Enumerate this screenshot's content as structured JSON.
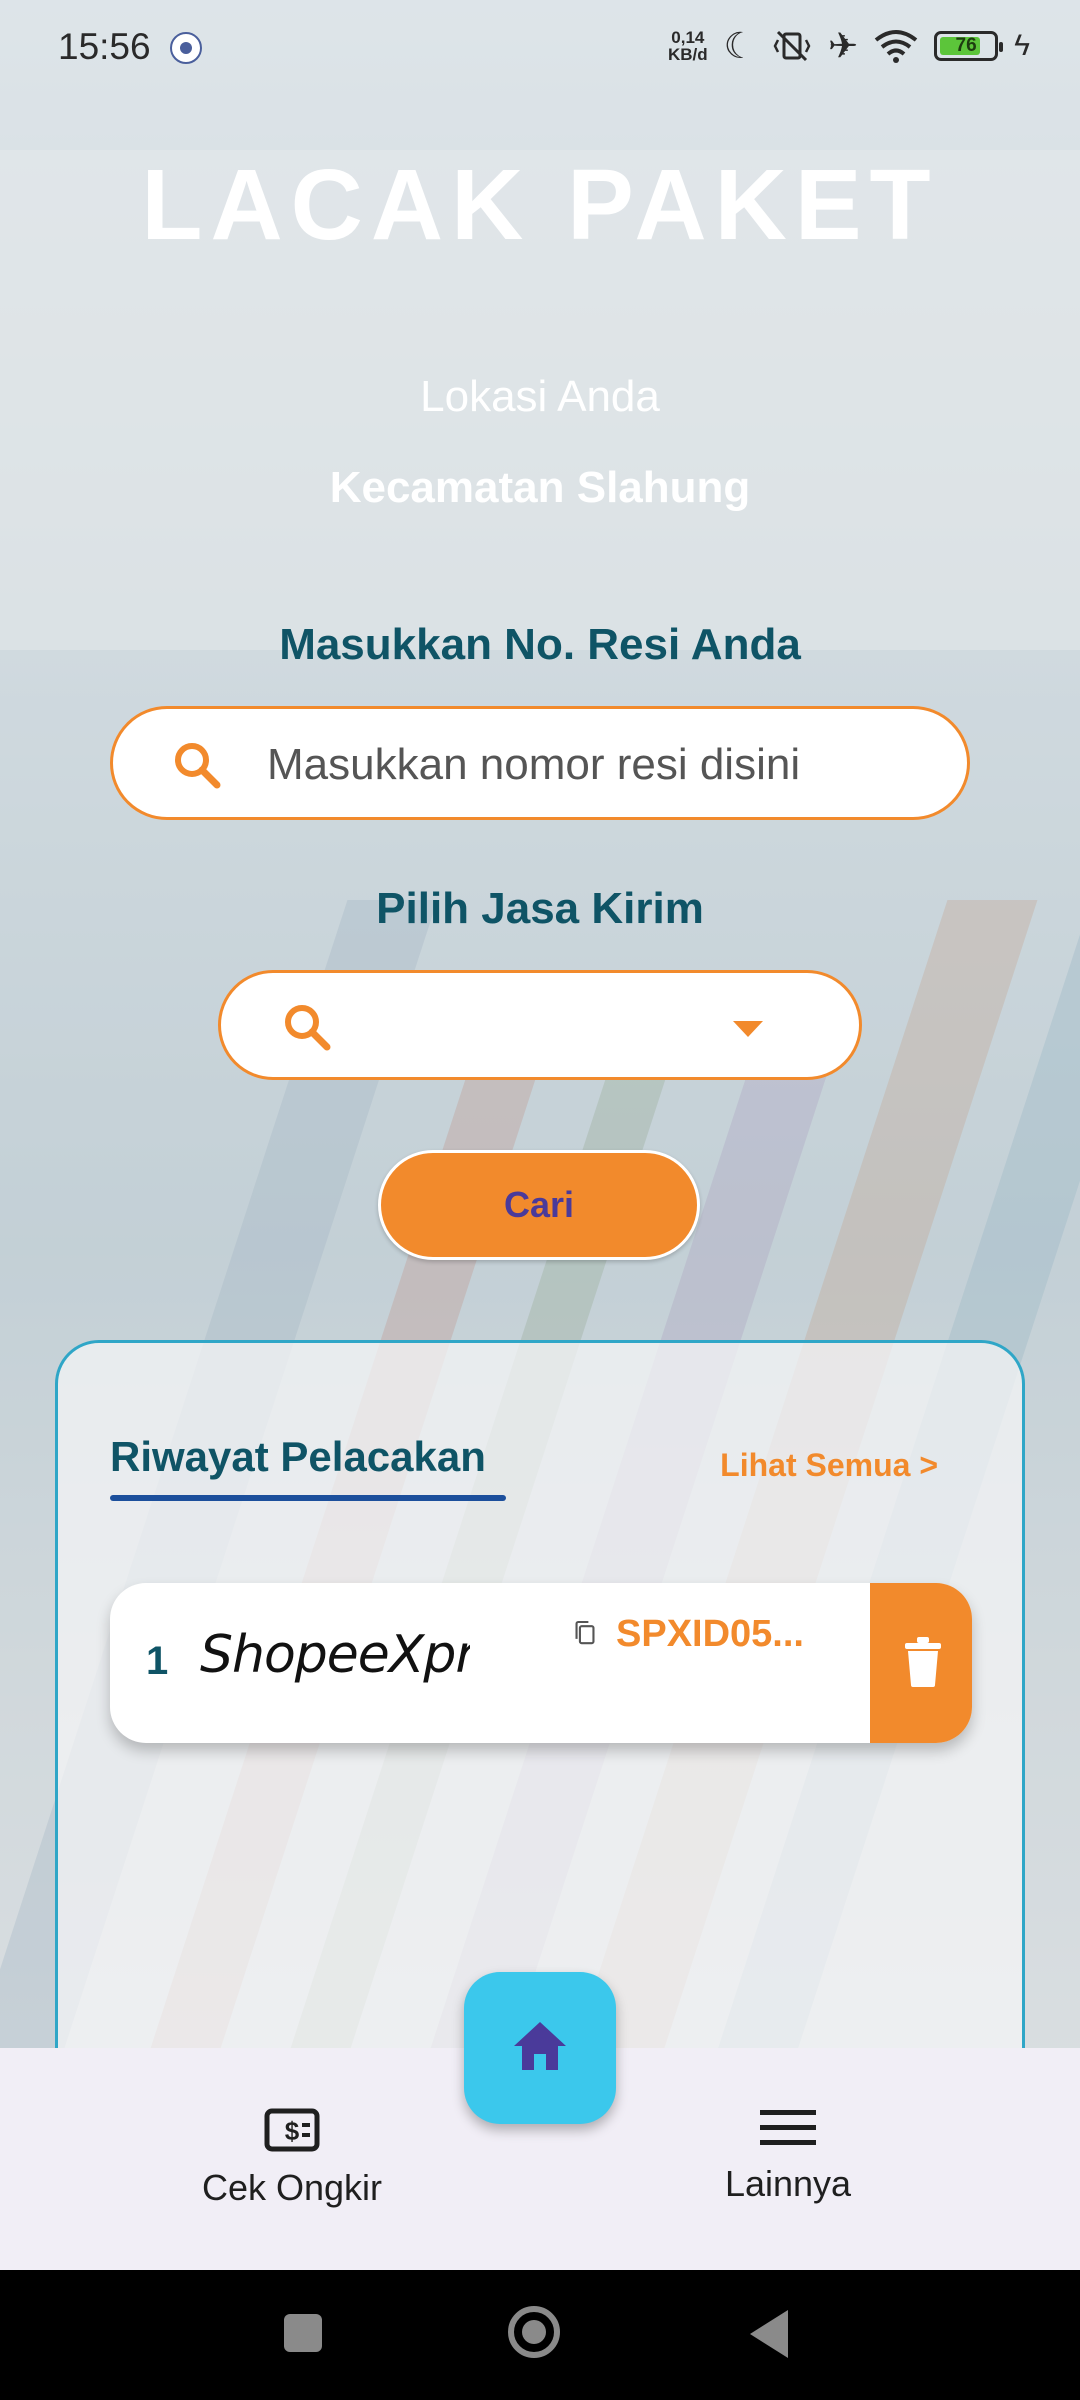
{
  "status_bar": {
    "time": "15:56",
    "net_speed_value": "0,14",
    "net_speed_unit": "KB/d",
    "battery_level": "76",
    "icons": [
      "settings-icon",
      "moon-icon",
      "vibrate-off-icon",
      "airplane-icon",
      "wifi-icon",
      "battery-icon",
      "charging-icon"
    ]
  },
  "header": {
    "title": "LACAK PAKET",
    "location_label": "Lokasi Anda",
    "location_value": "Kecamatan Slahung"
  },
  "form": {
    "resi_label": "Masukkan No. Resi Anda",
    "resi_placeholder": "Masukkan nomor resi disini",
    "courier_label": "Pilih Jasa Kirim",
    "courier_value": "",
    "search_button": "Cari"
  },
  "history": {
    "title": "Riwayat Pelacakan",
    "see_all": "Lihat Semua >",
    "items": [
      {
        "number": "1",
        "courier": "ShopeeXpress",
        "resi": "SPXID05..."
      }
    ]
  },
  "bottom_nav": {
    "left_label": "Cek Ongkir",
    "right_label": "Lainnya",
    "center_icon": "home-icon"
  },
  "colors": {
    "accent": "#f28a2c",
    "teal_text": "#0f5466",
    "fab": "#3bc8ec",
    "panel_border": "#2fa6c7"
  }
}
